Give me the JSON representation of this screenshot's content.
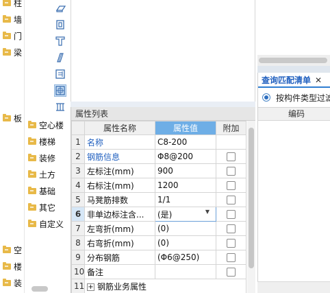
{
  "tree_left": [
    {
      "label": "柱"
    },
    {
      "label": "墙"
    },
    {
      "label": "门"
    },
    {
      "label": "梁"
    },
    {
      "label": "板"
    },
    {
      "label": "空"
    },
    {
      "label": "楼"
    },
    {
      "label": "装"
    }
  ],
  "tree_mid": [
    {
      "label": "空心楼"
    },
    {
      "label": "楼梯"
    },
    {
      "label": "装修"
    },
    {
      "label": "土方"
    },
    {
      "label": "基础"
    },
    {
      "label": "其它"
    },
    {
      "label": "自定义"
    }
  ],
  "toolbar_icons": [
    "slab-icon",
    "stirrup-icon",
    "column-cap-icon",
    "slanted-bar-icon",
    "grid-panel-icon",
    "selected-grid-icon",
    "bars-icon"
  ],
  "properties": {
    "title": "属性列表",
    "columns": [
      "属性名称",
      "属性值",
      "附加"
    ],
    "rows": [
      {
        "idx": "1",
        "name": "名称",
        "value": "C8-200",
        "blue": true,
        "checkbox": false
      },
      {
        "idx": "2",
        "name": "钢筋信息",
        "value": "Φ8@200",
        "blue": true,
        "checkbox": true
      },
      {
        "idx": "3",
        "name": "左标注(mm)",
        "value": "900",
        "blue": false,
        "checkbox": true
      },
      {
        "idx": "4",
        "name": "右标注(mm)",
        "value": "1200",
        "blue": false,
        "checkbox": true
      },
      {
        "idx": "5",
        "name": "马凳筋排数",
        "value": "1/1",
        "blue": false,
        "checkbox": true
      },
      {
        "idx": "6",
        "name": "非单边标注含...",
        "value": "(是)",
        "blue": false,
        "checkbox": true
      },
      {
        "idx": "7",
        "name": "左弯折(mm)",
        "value": "(0)",
        "blue": false,
        "checkbox": true
      },
      {
        "idx": "8",
        "name": "右弯折(mm)",
        "value": "(0)",
        "blue": false,
        "checkbox": true
      },
      {
        "idx": "9",
        "name": "分布钢筋",
        "value": "(Φ6@250)",
        "blue": false,
        "checkbox": true
      },
      {
        "idx": "10",
        "name": "备注",
        "value": "",
        "blue": false,
        "checkbox": true
      }
    ],
    "group_row": {
      "idx": "11",
      "plus": "+",
      "name": "钢筋业务属性"
    },
    "active_row": 6
  },
  "query_panel": {
    "tab_label": "查询匹配清单",
    "close_glyph": "✕",
    "radio_label": "按构件类型过滤",
    "column_header": "编码"
  },
  "colors": {
    "accent": "#6eaee6",
    "link": "#1f5fbf",
    "folder": "#e8b948"
  }
}
